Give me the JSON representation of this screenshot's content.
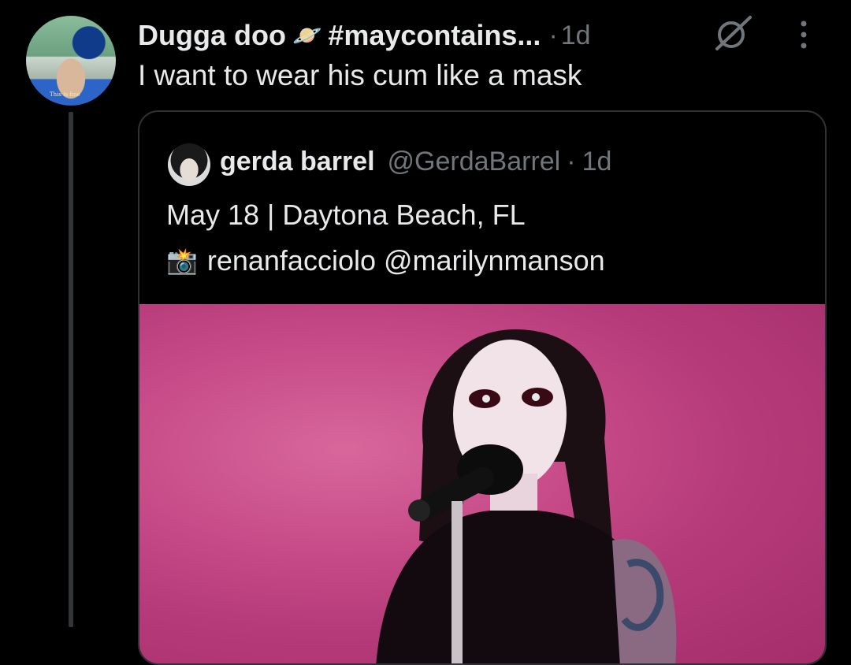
{
  "reply": {
    "author_name": "Dugga doo",
    "author_emoji": "🪐",
    "author_tag": "#maycontains...",
    "separator": "·",
    "time": "1d",
    "text": "I want to wear his cum like a mask",
    "avatar_caption": "This is fine"
  },
  "quoted": {
    "author_name": "gerda barrel",
    "handle": "@GerdaBarrel",
    "separator": "·",
    "time": "1d",
    "line1": "May 18 | Daytona Beach, FL",
    "camera_emoji": "📸",
    "line2": "renanfacciolo @marilynmanson"
  },
  "icons": {
    "grok": "grok-icon",
    "more": "more-vertical-icon"
  },
  "colors": {
    "background": "#000000",
    "text_primary": "#e7e9ea",
    "text_secondary": "#71767b",
    "border": "#2f3336",
    "image_backdrop": "#c64a87"
  }
}
